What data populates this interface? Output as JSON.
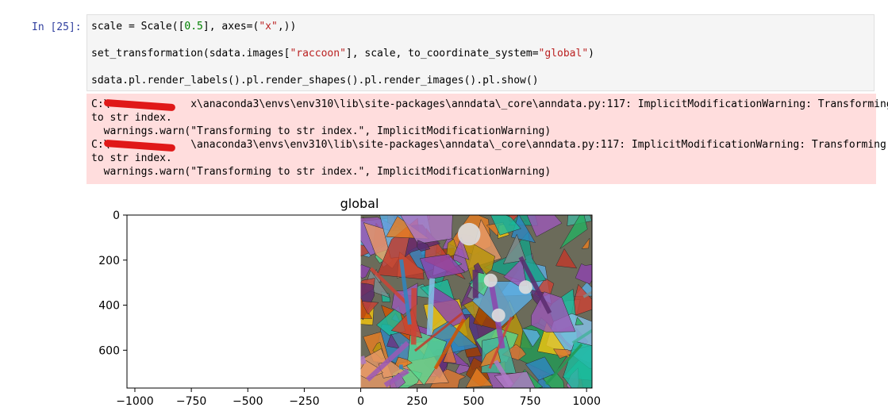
{
  "cell": {
    "prompt": "In [25]:",
    "code": [
      [
        {
          "t": "scale = Scale(["
        },
        {
          "t": "0.5",
          "c": "num"
        },
        {
          "t": "], axes=("
        },
        {
          "t": "\"x\"",
          "c": "str"
        },
        {
          "t": ",))"
        }
      ],
      [
        {
          "t": "set_transformation(sdata.images["
        },
        {
          "t": "\"raccoon\"",
          "c": "str"
        },
        {
          "t": "], scale, to_coordinate_system="
        },
        {
          "t": "\"global\"",
          "c": "str"
        },
        {
          "t": ")"
        }
      ],
      [
        {
          "t": "sdata.pl.render_labels().pl.render_shapes().pl.render_images().pl.show()"
        }
      ]
    ]
  },
  "stderr": {
    "lines": [
      "C:\\             x\\anaconda3\\envs\\env310\\lib\\site-packages\\anndata\\_core\\anndata.py:117: ImplicitModificationWarning: Transforming",
      "to str index.",
      "  warnings.warn(\"Transforming to str index.\", ImplicitModificationWarning)",
      "C:\\             \\anaconda3\\envs\\env310\\lib\\site-packages\\anndata\\_core\\anndata.py:117: ImplicitModificationWarning: Transforming",
      "to str index.",
      "  warnings.warn(\"Transforming to str index.\", ImplicitModificationWarning)"
    ]
  },
  "chart_data": {
    "type": "image",
    "title": "global",
    "xlim": [
      -1035,
      1024
    ],
    "ylim": [
      768,
      0
    ],
    "xticks": [
      -1000,
      -750,
      -500,
      -250,
      0,
      250,
      500,
      750,
      1000
    ],
    "xtick_labels": [
      "−1000",
      "−750",
      "−500",
      "−250",
      "0",
      "250",
      "500",
      "750",
      "1000"
    ],
    "yticks": [
      0,
      200,
      400,
      600
    ],
    "ytick_labels": [
      "0",
      "200",
      "400",
      "600"
    ],
    "image_extent": {
      "x": [
        0,
        1024
      ],
      "y": [
        0,
        768
      ]
    },
    "circles": [
      {
        "x": 480,
        "y": 85,
        "r": 50
      },
      {
        "x": 575,
        "y": 290,
        "r": 30
      },
      {
        "x": 730,
        "y": 320,
        "r": 30
      },
      {
        "x": 610,
        "y": 445,
        "r": 30
      }
    ],
    "colors": {
      "circle": "#dcdcdc"
    }
  }
}
